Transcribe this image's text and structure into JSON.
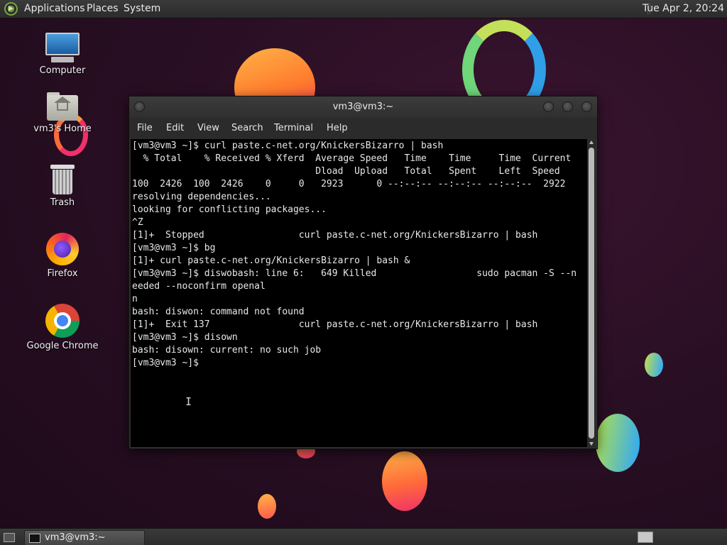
{
  "top_panel": {
    "menus": [
      "Applications",
      "Places",
      "System"
    ],
    "clock": "Tue Apr 2, 20:24"
  },
  "desktop_icons": [
    {
      "label": "Computer",
      "icon": "computer-icon"
    },
    {
      "label": "vm3's Home",
      "icon": "home-folder-icon"
    },
    {
      "label": "Trash",
      "icon": "trash-icon"
    },
    {
      "label": "Firefox",
      "icon": "firefox-icon"
    },
    {
      "label": "Google Chrome",
      "icon": "chrome-icon"
    }
  ],
  "terminal": {
    "title": "vm3@vm3:~",
    "menu": [
      "File",
      "Edit",
      "View",
      "Search",
      "Terminal",
      "Help"
    ],
    "lines": [
      "[vm3@vm3 ~]$ curl paste.c-net.org/KnickersBizarro | bash",
      "  % Total    % Received % Xferd  Average Speed   Time    Time     Time  Current",
      "                                 Dload  Upload   Total   Spent    Left  Speed",
      "100  2426  100  2426    0     0   2923      0 --:--:-- --:--:-- --:--:--  2922",
      "resolving dependencies...",
      "looking for conflicting packages...",
      "^Z",
      "[1]+  Stopped                 curl paste.c-net.org/KnickersBizarro | bash",
      "[vm3@vm3 ~]$ bg",
      "[1]+ curl paste.c-net.org/KnickersBizarro | bash &",
      "[vm3@vm3 ~]$ diswobash: line 6:   649 Killed                  sudo pacman -S --n",
      "eeded --noconfirm openal",
      "n",
      "bash: diswon: command not found",
      "[1]+  Exit 137                curl paste.c-net.org/KnickersBizarro | bash",
      "[vm3@vm3 ~]$ disown",
      "bash: disown: current: no such job",
      "[vm3@vm3 ~]$ "
    ]
  },
  "taskbar": {
    "tasks": [
      {
        "label": "vm3@vm3:~"
      }
    ]
  },
  "colors": {
    "desktop_bg": "#2a0f24",
    "terminal_bg": "#000000",
    "terminal_fg": "#e8e8e8",
    "panel_bg": "#2f2f2f"
  }
}
